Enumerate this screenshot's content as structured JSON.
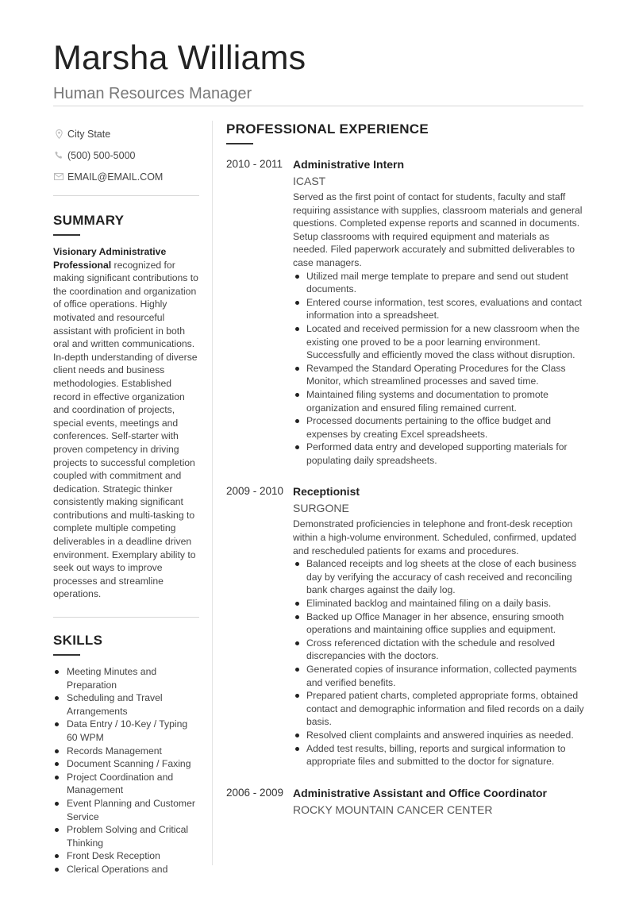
{
  "header": {
    "name": "Marsha Williams",
    "title": "Human Resources Manager"
  },
  "contact": {
    "location": "City State",
    "phone": "(500) 500-5000",
    "email": "EMAIL@EMAIL.COM",
    "icons": [
      "map-pin-icon",
      "phone-icon",
      "envelope-icon"
    ]
  },
  "summary": {
    "heading": "SUMMARY",
    "lead": "Visionary Administrative Professional",
    "text": " recognized for making significant contributions to the coordination and organization of office operations. Highly motivated and resourceful assistant with proficient in both oral and written communications. In-depth understanding of diverse client needs and business methodologies. Established record in effective organization and coordination of projects, special events, meetings and conferences. Self-starter with proven competency in driving projects to successful completion coupled with commitment and dedication. Strategic thinker consistently making significant contributions and multi-tasking to complete multiple competing deliverables in a deadline driven environment. Exemplary ability to seek out ways to improve processes and streamline operations."
  },
  "skills": {
    "heading": "SKILLS",
    "items": [
      "Meeting Minutes and Preparation",
      "Scheduling and Travel Arrangements",
      "Data Entry / 10-Key / Typing 60 WPM",
      "Records Management",
      "Document Scanning / Faxing",
      "Project Coordination and Management",
      "Event Planning and Customer Service",
      "Problem Solving and Critical Thinking",
      "Front Desk Reception",
      "Clerical Operations and"
    ]
  },
  "experience": {
    "heading": "PROFESSIONAL EXPERIENCE",
    "jobs": [
      {
        "dates": "2010 - 2011",
        "title": "Administrative Intern",
        "company": "ICAST",
        "description": "Served as the first point of contact for students, faculty and staff requiring assistance with supplies, classroom materials and general questions. Completed expense reports and scanned in documents. Setup classrooms with required equipment and materials as needed. Filed paperwork accurately and submitted deliverables to case managers.",
        "bullets": [
          "Utilized mail merge template to prepare and send out student documents.",
          "Entered course information, test scores, evaluations and contact information into a spreadsheet.",
          "Located and received permission for a new classroom when the existing one proved to be a poor learning environment. Successfully and efficiently moved the class without disruption.",
          "Revamped the Standard Operating Procedures for the Class Monitor, which streamlined processes and saved time.",
          "Maintained filing systems and documentation to promote organization and ensured filing remained current.",
          "Processed documents pertaining to the office budget and expenses by creating Excel spreadsheets.",
          "Performed data entry and developed supporting materials for populating daily spreadsheets."
        ]
      },
      {
        "dates": "2009 - 2010",
        "title": "Receptionist",
        "company": "SURGONE",
        "description": "Demonstrated proficiencies in telephone and front-desk reception within a high-volume environment. Scheduled, confirmed, updated and rescheduled patients for exams and procedures.",
        "bullets": [
          "Balanced receipts and log sheets at the close of each business day by verifying the accuracy of cash received and reconciling bank charges against the daily log.",
          "Eliminated backlog and maintained filing on a daily basis.",
          "Backed up Office Manager in her absence, ensuring smooth operations and maintaining office supplies and equipment.",
          "Cross referenced dictation with the schedule and resolved discrepancies with the doctors.",
          "Generated copies of insurance information, collected payments and verified benefits.",
          "Prepared patient charts, completed appropriate forms, obtained contact and demographic information and filed records on a daily basis.",
          "Resolved client complaints and answered inquiries as needed.",
          "Added test results, billing, reports and surgical information to appropriate files and submitted to the doctor for signature."
        ]
      },
      {
        "dates": "2006 - 2009",
        "title": "Administrative Assistant and Office Coordinator",
        "company": "ROCKY MOUNTAIN CANCER CENTER",
        "description": "",
        "bullets": []
      }
    ]
  }
}
